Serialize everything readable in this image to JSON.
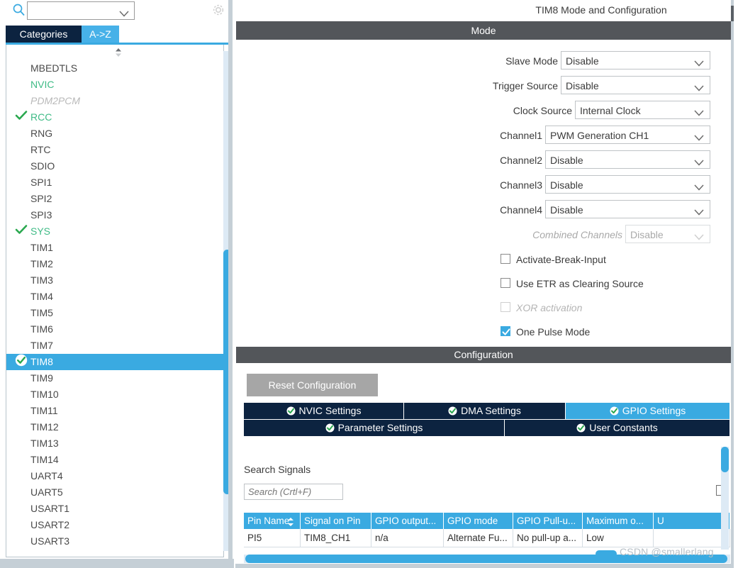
{
  "left_panel": {
    "search": {
      "value": "",
      "icon": "search-icon"
    },
    "gear": {
      "icon": "gear-icon"
    },
    "tabs": [
      {
        "label": "Categories",
        "active": true
      },
      {
        "label": "A->Z",
        "active": false
      }
    ],
    "modules": [
      {
        "label": "MBEDTLS",
        "state": "normal"
      },
      {
        "label": "NVIC",
        "state": "enabled"
      },
      {
        "label": "PDM2PCM",
        "state": "dim"
      },
      {
        "label": "RCC",
        "state": "enabled",
        "check": "green-check"
      },
      {
        "label": "RNG",
        "state": "normal"
      },
      {
        "label": "RTC",
        "state": "normal"
      },
      {
        "label": "SDIO",
        "state": "normal"
      },
      {
        "label": "SPI1",
        "state": "normal"
      },
      {
        "label": "SPI2",
        "state": "normal"
      },
      {
        "label": "SPI3",
        "state": "normal"
      },
      {
        "label": "SYS",
        "state": "enabled",
        "check": "green-check"
      },
      {
        "label": "TIM1",
        "state": "normal"
      },
      {
        "label": "TIM2",
        "state": "normal"
      },
      {
        "label": "TIM3",
        "state": "normal"
      },
      {
        "label": "TIM4",
        "state": "normal"
      },
      {
        "label": "TIM5",
        "state": "normal"
      },
      {
        "label": "TIM6",
        "state": "normal"
      },
      {
        "label": "TIM7",
        "state": "normal"
      },
      {
        "label": "TIM8",
        "state": "selected",
        "check": "green-check-circle"
      },
      {
        "label": "TIM9",
        "state": "normal"
      },
      {
        "label": "TIM10",
        "state": "normal"
      },
      {
        "label": "TIM11",
        "state": "normal"
      },
      {
        "label": "TIM12",
        "state": "normal"
      },
      {
        "label": "TIM13",
        "state": "normal"
      },
      {
        "label": "TIM14",
        "state": "normal"
      },
      {
        "label": "UART4",
        "state": "normal"
      },
      {
        "label": "UART5",
        "state": "normal"
      },
      {
        "label": "USART1",
        "state": "normal"
      },
      {
        "label": "USART2",
        "state": "normal"
      },
      {
        "label": "USART3",
        "state": "normal"
      }
    ]
  },
  "right_panel": {
    "title": "TIM8 Mode and Configuration",
    "mode_header": "Mode",
    "mode_rows": [
      {
        "label": "Slave Mode",
        "value": "Disable",
        "disabled": false
      },
      {
        "label": "Trigger Source",
        "value": "Disable",
        "disabled": false
      },
      {
        "label": "Clock Source",
        "value": "Internal Clock",
        "disabled": false
      },
      {
        "label": "Channel1",
        "value": "PWM Generation CH1",
        "disabled": false
      },
      {
        "label": "Channel2",
        "value": "Disable",
        "disabled": false
      },
      {
        "label": "Channel3",
        "value": "Disable",
        "disabled": false
      },
      {
        "label": "Channel4",
        "value": "Disable",
        "disabled": false
      },
      {
        "label": "Combined Channels",
        "value": "Disable",
        "disabled": true
      }
    ],
    "checkboxes": [
      {
        "label": "Activate-Break-Input",
        "checked": false,
        "disabled": false
      },
      {
        "label": "Use ETR as Clearing Source",
        "checked": false,
        "disabled": false
      },
      {
        "label": "XOR activation",
        "checked": false,
        "disabled": true
      },
      {
        "label": "One Pulse Mode",
        "checked": true,
        "disabled": false
      }
    ],
    "configuration_header": "Configuration",
    "reset_button": "Reset Configuration",
    "config_tabs_row1": [
      {
        "label": "NVIC Settings",
        "active": false
      },
      {
        "label": "DMA Settings",
        "active": false
      },
      {
        "label": "GPIO Settings",
        "active": true
      }
    ],
    "config_tabs_row2": [
      {
        "label": "Parameter Settings",
        "active": false
      },
      {
        "label": "User Constants",
        "active": false
      }
    ],
    "gpio": {
      "search_signals_label": "Search Signals",
      "search_placeholder": "Search (Crtl+F)",
      "search_value": "",
      "columns": [
        "Pin Name",
        "Signal on Pin",
        "GPIO output...",
        "GPIO mode",
        "GPIO Pull-u...",
        "Maximum o...",
        "U"
      ],
      "rows": [
        [
          "PI5",
          "TIM8_CH1",
          "n/a",
          "Alternate Fu...",
          "No pull-up a...",
          "Low",
          ""
        ]
      ]
    }
  },
  "watermark": "CSDN @smallerlang",
  "colors": {
    "accent_blue": "#3aaae1",
    "tab_navy": "#0c2340",
    "header_gray": "#53565a",
    "enabled_green": "#3fbb86"
  }
}
